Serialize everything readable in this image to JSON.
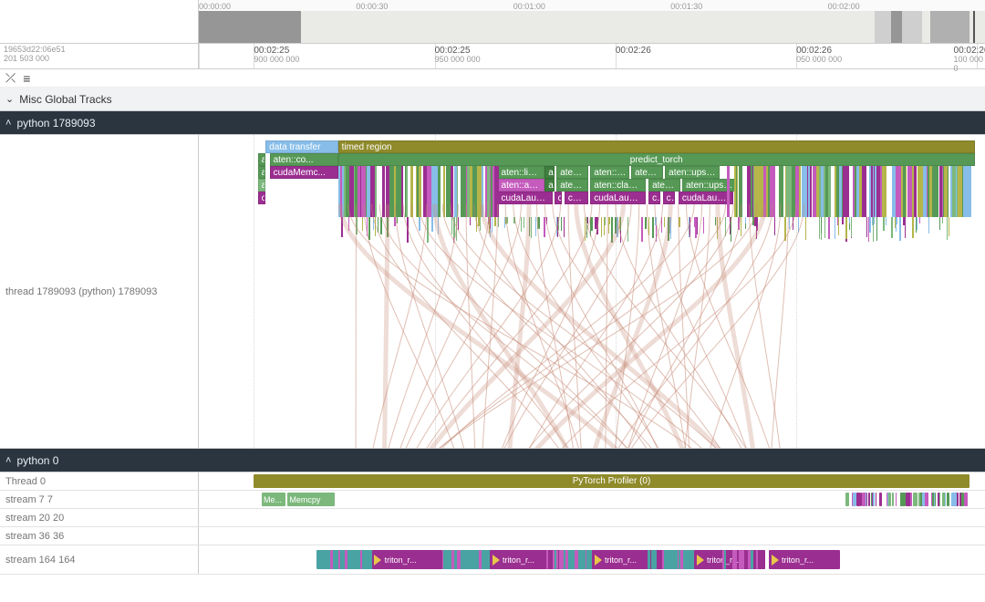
{
  "overview": {
    "ticks": [
      "00:00:00",
      "00:00:30",
      "00:01:00",
      "00:01:30",
      "00:02:00"
    ]
  },
  "timeaxis": {
    "trace_id": "19653d22:06e51",
    "trace_sub": "201 503 000",
    "labels": [
      {
        "t": "00:02:25",
        "sub": "900 000 000"
      },
      {
        "t": "00:02:25",
        "sub": "950 000 000"
      },
      {
        "t": "00:02:26",
        "sub": ""
      },
      {
        "t": "00:02:26",
        "sub": "050 000 000"
      },
      {
        "t": "00:02:26",
        "sub": "100 000 0"
      }
    ]
  },
  "sections": {
    "misc": "Misc Global Tracks",
    "python_main": "python 1789093",
    "python_zero": "python 0"
  },
  "thread_label": "thread 1789093 (python) 1789093",
  "flame": {
    "data_transfer": "data transfer",
    "timed_region": "timed region",
    "predict_torch": "predict_torch",
    "at": "at...",
    "cu": "cu...",
    "aten_co": "aten::co...",
    "cuda_memc": "cudaMemc...",
    "aten_line": "aten::line...",
    "a": "a",
    "aten_": "aten::...",
    "aten_relu": "aten::relu",
    "aten_dots": "aten:...",
    "aten_upsampl": "aten::upsampl...",
    "aten_addmm": "aten::addmm",
    "aten_clamp_m": "aten::clamp_m...",
    "cuda_launch_ker": "cudaLaunchKer...",
    "c": "c",
    "c_dots": "c..."
  },
  "bottom": {
    "thread0": "Thread 0",
    "thread0_label": "PyTorch Profiler (0)",
    "stream7": "stream 7 7",
    "stream7_me": "Me...",
    "stream7_memcpy": "Memcpy H...",
    "stream20": "stream 20 20",
    "stream36": "stream 36 36",
    "stream164": "stream 164 164",
    "triton_r": "triton_r..."
  },
  "colors": {
    "blue": "#87bde8",
    "olive": "#8f8a2a",
    "green": "#569956",
    "purple": "#9b2e91",
    "magenta": "#c45bbd",
    "brown": "#7a5f3a",
    "teal": "#4aa3a3",
    "flow": "#c78a76"
  }
}
